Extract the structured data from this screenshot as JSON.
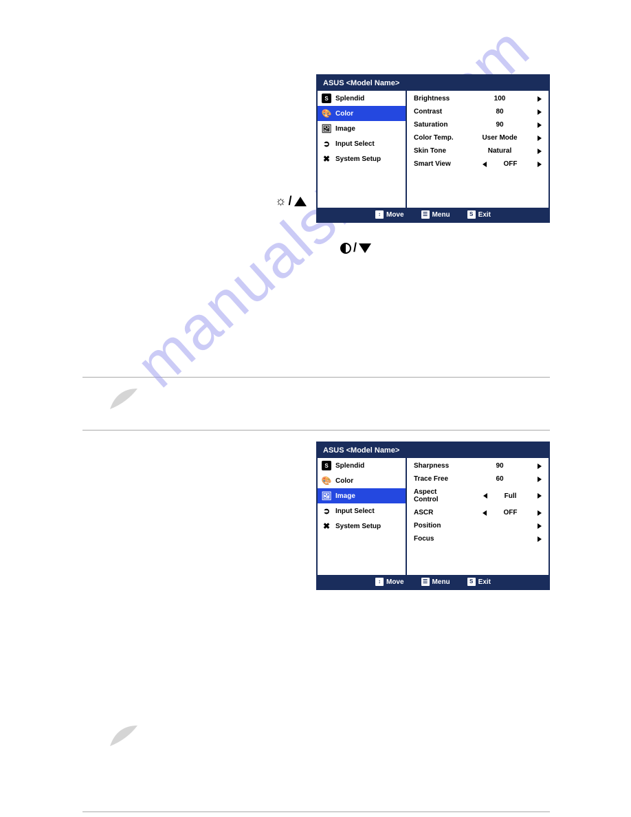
{
  "watermark": "manualshive.com",
  "hotkey1_icon": "brightness-up",
  "hotkey2_icon": "contrast-down",
  "osd1": {
    "title": "ASUS  <Model Name>",
    "left": [
      {
        "icon": "S",
        "label": "Splendid"
      },
      {
        "icon": "color",
        "label": "Color",
        "selected": true
      },
      {
        "icon": "image",
        "label": "Image"
      },
      {
        "icon": "input",
        "label": "Input Select"
      },
      {
        "icon": "setup",
        "label": "System Setup"
      }
    ],
    "right": [
      {
        "label": "Brightness",
        "value": "100",
        "arrow": true
      },
      {
        "label": "Contrast",
        "value": "80",
        "arrow": true
      },
      {
        "label": "Saturation",
        "value": "90",
        "arrow": true
      },
      {
        "label": "Color Temp.",
        "value": "User Mode",
        "arrow": true
      },
      {
        "label": "Skin Tone",
        "value": "Natural",
        "arrow": true
      },
      {
        "label": "Smart View",
        "value": "OFF",
        "left_arrow": true,
        "arrow": true
      }
    ],
    "footer": {
      "move": "Move",
      "menu": "Menu",
      "exit": "Exit"
    }
  },
  "osd2": {
    "title": "ASUS  <Model Name>",
    "left": [
      {
        "icon": "S",
        "label": "Splendid"
      },
      {
        "icon": "color",
        "label": "Color"
      },
      {
        "icon": "image",
        "label": "Image",
        "selected": true
      },
      {
        "icon": "input",
        "label": "Input Select"
      },
      {
        "icon": "setup",
        "label": "System Setup"
      }
    ],
    "right": [
      {
        "label": "Sharpness",
        "value": "90",
        "arrow": true
      },
      {
        "label": "Trace Free",
        "value": "60",
        "arrow": true
      },
      {
        "label": "Aspect Control",
        "value": "Full",
        "left_arrow": true,
        "arrow": true
      },
      {
        "label": "ASCR",
        "value": "OFF",
        "left_arrow": true,
        "arrow": true
      },
      {
        "label": "Position",
        "value": "",
        "arrow": true
      },
      {
        "label": "Focus",
        "value": "",
        "arrow": true
      }
    ],
    "footer": {
      "move": "Move",
      "menu": "Menu",
      "exit": "Exit"
    }
  }
}
